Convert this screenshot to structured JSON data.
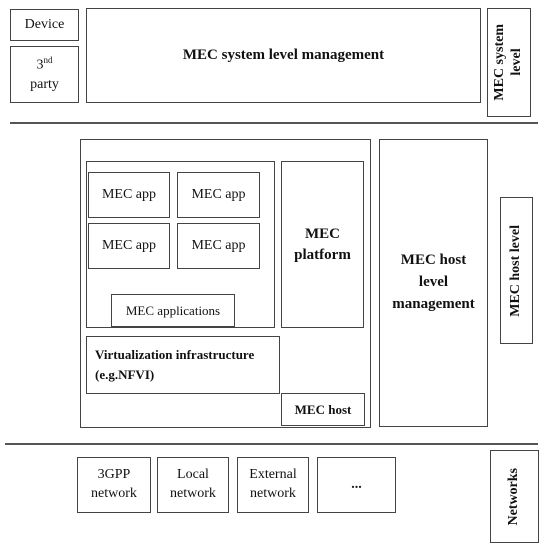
{
  "system_level": {
    "device": "Device",
    "third_party_num": "3",
    "third_party_sup": "nd",
    "third_party_word": "party",
    "management": "MEC system level management",
    "level_label_line1": "MEC system",
    "level_label_line2": "level"
  },
  "host_level": {
    "apps": [
      "MEC app",
      "MEC app",
      "MEC app",
      "MEC app"
    ],
    "applications_label": "MEC applications",
    "platform_line1": "MEC",
    "platform_line2": "platform",
    "virtualization_line1": "Virtualization infrastructure",
    "virtualization_line2": "(e.g.NFVI)",
    "host_label": "MEC host",
    "management_line1": "MEC host",
    "management_line2": "level",
    "management_line3": "management",
    "level_label": "MEC host level"
  },
  "networks": {
    "items": [
      {
        "line1": "3GPP",
        "line2": "network"
      },
      {
        "line1": "Local",
        "line2": "network"
      },
      {
        "line1": "External",
        "line2": "network"
      },
      {
        "line1": "...",
        "line2": ""
      }
    ],
    "level_label": "Networks"
  }
}
